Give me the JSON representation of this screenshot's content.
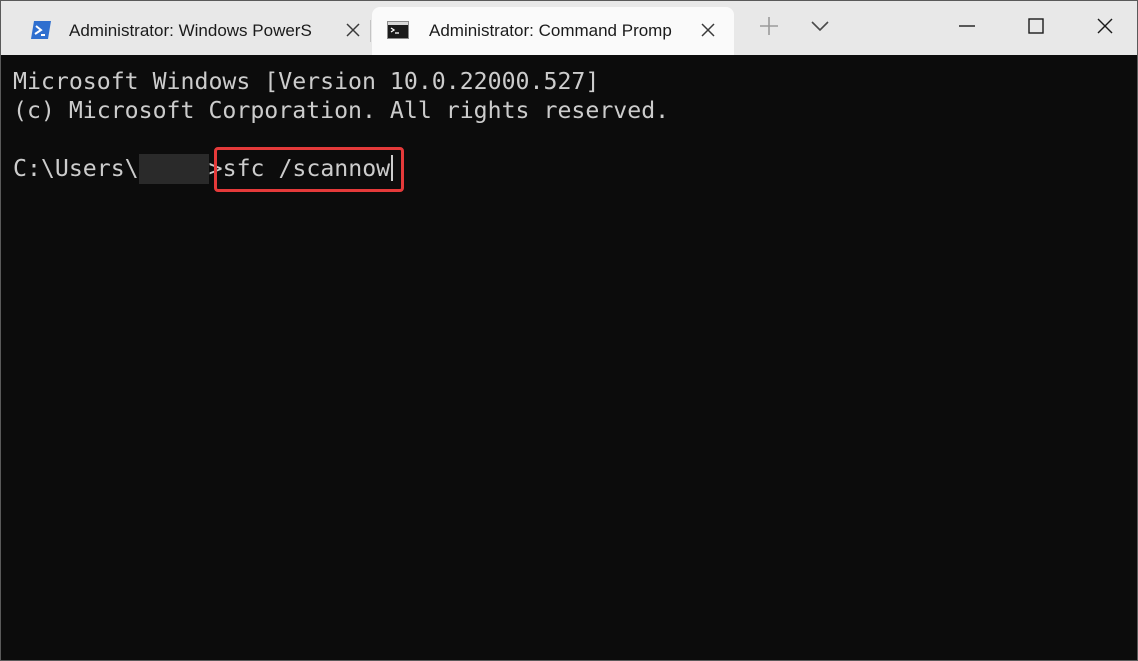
{
  "tabs": [
    {
      "label": "Administrator: Windows PowerS",
      "active": false,
      "icon": "powershell-icon"
    },
    {
      "label": "Administrator: Command Promp",
      "active": true,
      "icon": "command-prompt-icon"
    }
  ],
  "titlebar": {
    "new_tab_icon": "plus-icon",
    "dropdown_icon": "chevron-down-icon",
    "minimize_icon": "minimize-icon",
    "maximize_icon": "maximize-icon",
    "close_icon": "close-icon"
  },
  "terminal": {
    "lines": [
      "Microsoft Windows [Version 10.0.22000.527]",
      "(c) Microsoft Corporation. All rights reserved."
    ],
    "prompt_prefix": "C:\\Users\\",
    "prompt_suffix": ">",
    "command": "sfc /scannow"
  },
  "colors": {
    "terminal_background": "#0c0c0c",
    "terminal_text": "#cccccc",
    "titlebar_background": "#e8e8e8",
    "active_tab_background": "#fafafa",
    "highlight_border": "#e53a3a",
    "powershell_icon": "#2f6fcf"
  }
}
